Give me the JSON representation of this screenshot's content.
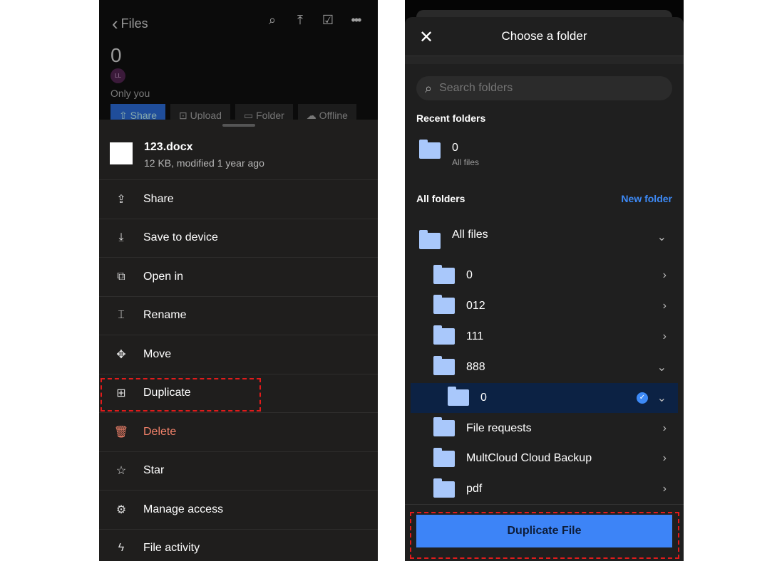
{
  "left": {
    "back_label": "Files",
    "folder_title": "0",
    "avatar_initials": "LL",
    "sharing": "Only you",
    "chips": [
      "⇧ Share",
      "⊡ Upload",
      "▭ Folder",
      "☁ Offline"
    ],
    "file": {
      "name": "123.docx",
      "meta": "12 KB, modified 1 year ago"
    },
    "menu": [
      {
        "icon": "share-icon",
        "glyph": "⇪",
        "label": "Share"
      },
      {
        "icon": "download-icon",
        "glyph": "⤓",
        "label": "Save to device"
      },
      {
        "icon": "open-external-icon",
        "glyph": "⧉",
        "label": "Open in"
      },
      {
        "icon": "rename-icon",
        "glyph": "⌶",
        "label": "Rename"
      },
      {
        "icon": "move-icon",
        "glyph": "✥",
        "label": "Move"
      },
      {
        "icon": "duplicate-icon",
        "glyph": "⊞",
        "label": "Duplicate"
      },
      {
        "icon": "trash-icon",
        "glyph": "🗑",
        "label": "Delete",
        "danger": true
      },
      {
        "icon": "star-icon",
        "glyph": "☆",
        "label": "Star"
      },
      {
        "icon": "gear-icon",
        "glyph": "⚙",
        "label": "Manage access"
      },
      {
        "icon": "bolt-icon",
        "glyph": "ϟ",
        "label": "File activity"
      }
    ]
  },
  "right": {
    "title": "Choose a folder",
    "search_placeholder": "Search folders",
    "recent_label": "Recent folders",
    "recent": {
      "name": "0",
      "sub": "All files"
    },
    "all_label": "All folders",
    "new_folder": "New folder",
    "root": "All files",
    "folders": [
      {
        "name": "0",
        "chev": "›"
      },
      {
        "name": "012",
        "chev": "›"
      },
      {
        "name": "111",
        "chev": "›"
      },
      {
        "name": "888",
        "chev": "⌄"
      },
      {
        "name": "0",
        "chev": "⌄",
        "selected": true,
        "indent": true
      },
      {
        "name": "File requests",
        "chev": "›"
      },
      {
        "name": "MultCloud Cloud Backup",
        "chev": "›"
      },
      {
        "name": "pdf",
        "chev": "›"
      }
    ],
    "button": "Duplicate File"
  },
  "colors": {
    "accent": "#3d84f7",
    "danger": "#f2826a",
    "highlight": "#e11b1b",
    "folder": "#a9c8fb"
  }
}
